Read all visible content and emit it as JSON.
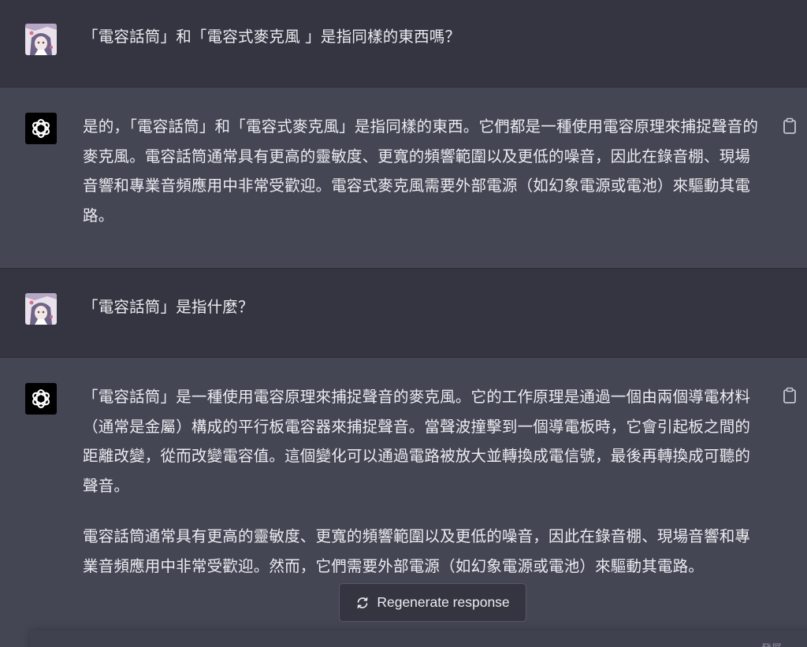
{
  "conversation": {
    "turns": [
      {
        "role": "user",
        "avatar_icon": "user-avatar-image",
        "paragraphs": [
          "「電容話筒」和「電容式麥克風 」是指同樣的東西嗎？"
        ]
      },
      {
        "role": "assistant",
        "avatar_icon": "openai-logo-icon",
        "paragraphs": [
          "是的，「電容話筒」和「電容式麥克風」是指同樣的東西。它們都是一種使用電容原理來捕捉聲音的麥克風。電容話筒通常具有更高的靈敏度、更寬的頻響範圍以及更低的噪音，因此在錄音棚、現場音響和專業音頻應用中非常受歡迎。電容式麥克風需要外部電源（如幻象電源或電池）來驅動其電路。"
        ]
      },
      {
        "role": "user",
        "avatar_icon": "user-avatar-image",
        "paragraphs": [
          "「電容話筒」是指什麼？"
        ]
      },
      {
        "role": "assistant",
        "avatar_icon": "openai-logo-icon",
        "paragraphs": [
          "「電容話筒」是一種使用電容原理來捕捉聲音的麥克風。它的工作原理是通過一個由兩個導電材料（通常是金屬）構成的平行板電容器來捕捉聲音。當聲波撞擊到一個導電板時，它會引起板之間的距離改變，從而改變電容值。這個變化可以通過電路被放大並轉換成電信號，最後再轉換成可聽的聲音。",
          "電容話筒通常具有更高的靈敏度、更寬的頻響範圍以及更低的噪音，因此在錄音棚、現場音響和專業音頻應用中非常受歡迎。然而，它們需要外部電源（如幻象電源或電池）來驅動其電路。"
        ]
      }
    ]
  },
  "regenerate_button": {
    "label": "Regenerate response",
    "icon": "refresh-icon"
  },
  "input": {
    "hint": "發展"
  },
  "colors": {
    "page_background": "#343541",
    "assistant_background": "#444654",
    "text": "#ececf1",
    "bot_avatar": "#000000"
  }
}
